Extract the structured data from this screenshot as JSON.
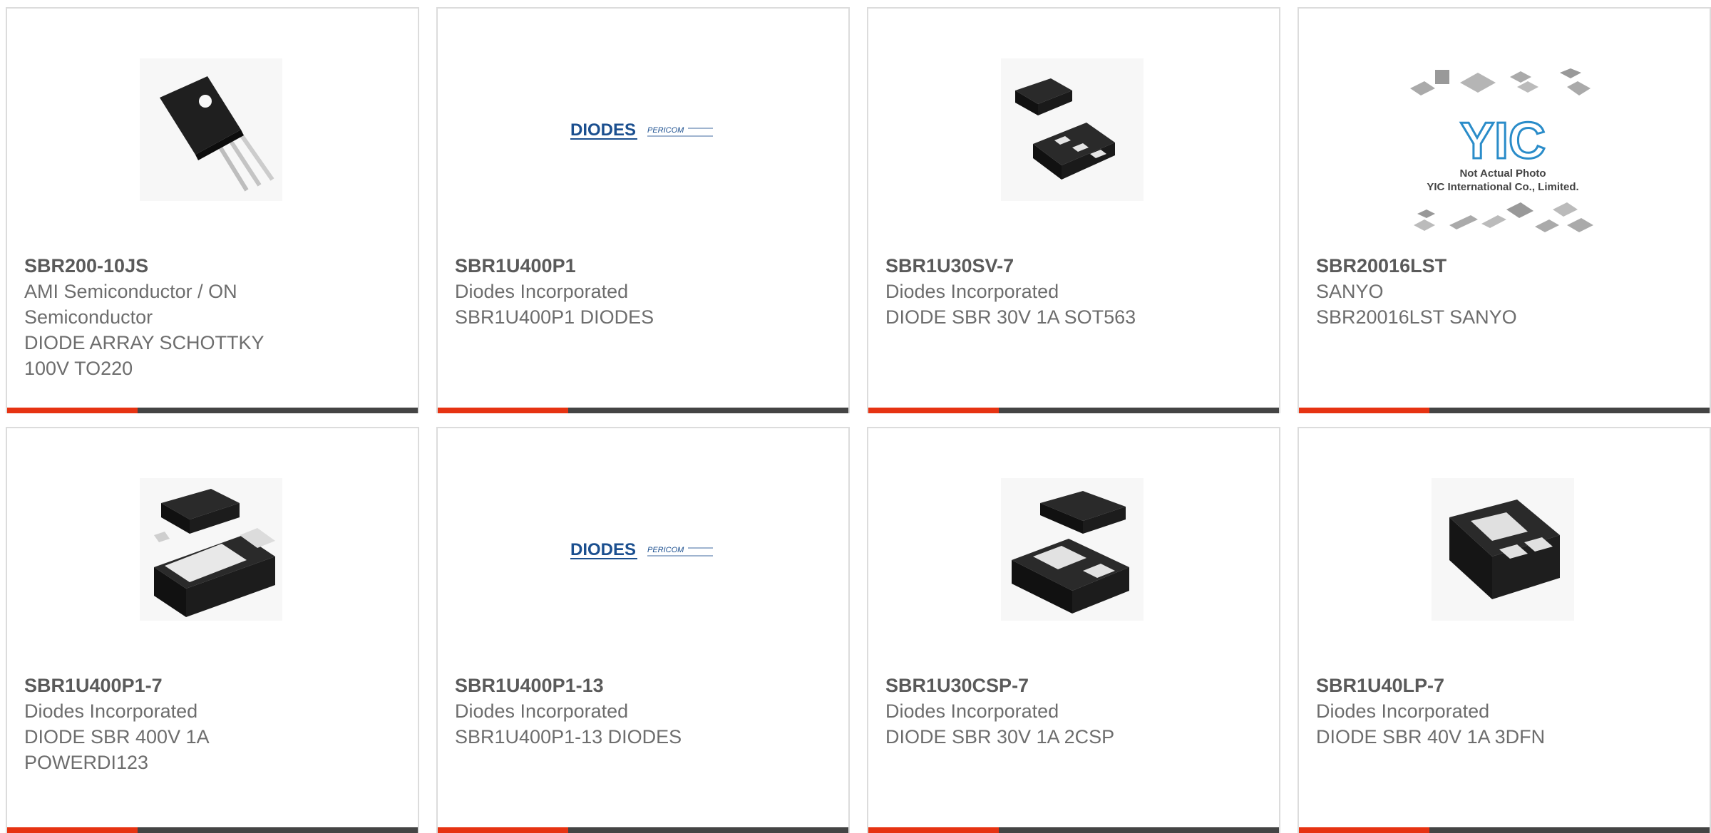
{
  "colors": {
    "accent": "#e63312",
    "bar": "#444444",
    "border": "#dcdcdc",
    "text": "#6d6d6d"
  },
  "products": [
    {
      "part_number": "SBR200-10JS",
      "manufacturer": "AMI Semiconductor / ON Semiconductor",
      "description": "DIODE ARRAY SCHOTTKY 100V TO220",
      "icon": "to220-package-icon"
    },
    {
      "part_number": "SBR1U400P1",
      "manufacturer": "Diodes Incorporated",
      "description": "SBR1U400P1 DIODES",
      "icon": "diodes-pericom-logo"
    },
    {
      "part_number": "SBR1U30SV-7",
      "manufacturer": "Diodes Incorporated",
      "description": "DIODE SBR 30V 1A SOT563",
      "icon": "sot563-package-icon"
    },
    {
      "part_number": "SBR20016LST",
      "manufacturer": "SANYO",
      "description": "SBR20016LST SANYO",
      "icon": "yic-placeholder-image",
      "placeholder_line1": "Not Actual Photo",
      "placeholder_line2": "YIC International Co., Limited.",
      "placeholder_logo": "YIC"
    },
    {
      "part_number": "SBR1U400P1-7",
      "manufacturer": "Diodes Incorporated",
      "description": "DIODE SBR 400V 1A POWERDI123",
      "icon": "powerdi123-package-icon"
    },
    {
      "part_number": "SBR1U400P1-13",
      "manufacturer": "Diodes Incorporated",
      "description": "SBR1U400P1-13 DIODES",
      "icon": "diodes-pericom-logo"
    },
    {
      "part_number": "SBR1U30CSP-7",
      "manufacturer": "Diodes Incorporated",
      "description": "DIODE SBR 30V 1A 2CSP",
      "icon": "2csp-package-icon"
    },
    {
      "part_number": "SBR1U40LP-7",
      "manufacturer": "Diodes Incorporated",
      "description": "DIODE SBR 40V 1A 3DFN",
      "icon": "3dfn-package-icon"
    }
  ],
  "logos": {
    "diodes": "DIODES",
    "pericom": "PERICOM"
  }
}
